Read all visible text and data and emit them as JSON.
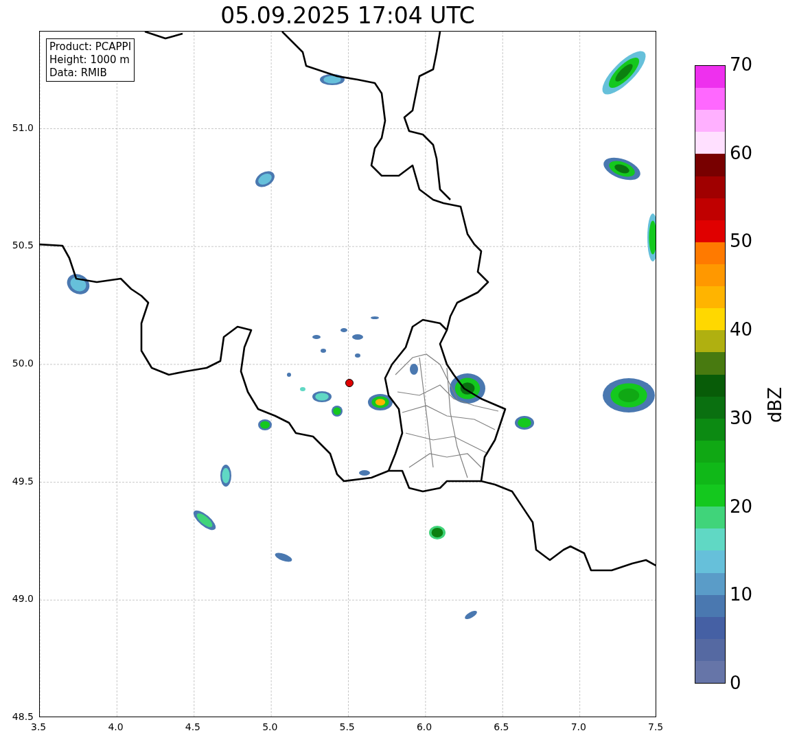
{
  "title": "05.09.2025 17:04 UTC",
  "info_box": [
    "Product: PCAPPI",
    "Height: 1000 m",
    "Data: RMIB"
  ],
  "x_axis": {
    "ticks": [
      "3.5",
      "4.0",
      "4.5",
      "5.0",
      "5.5",
      "6.0",
      "6.5",
      "7.0",
      "7.5"
    ]
  },
  "y_axis": {
    "ticks": [
      "51.0",
      "50.5",
      "50.0",
      "49.5",
      "49.0",
      "48.5"
    ]
  },
  "colorbar": {
    "label": "dBZ",
    "ticks": [
      "70",
      "60",
      "50",
      "40",
      "30",
      "20",
      "10",
      "0"
    ],
    "bands": [
      {
        "color": "#ee30ee"
      },
      {
        "color": "#ff68ff"
      },
      {
        "color": "#ffb0ff"
      },
      {
        "color": "#ffe0ff"
      },
      {
        "color": "#780000"
      },
      {
        "color": "#a00000"
      },
      {
        "color": "#c00000"
      },
      {
        "color": "#e00000"
      },
      {
        "color": "#ff7a00"
      },
      {
        "color": "#ff9800"
      },
      {
        "color": "#ffb400"
      },
      {
        "color": "#ffd800"
      },
      {
        "color": "#b0b010"
      },
      {
        "color": "#487a10"
      },
      {
        "color": "#085c08"
      },
      {
        "color": "#0a7010"
      },
      {
        "color": "#0c8a12"
      },
      {
        "color": "#10a814"
      },
      {
        "color": "#10b818"
      },
      {
        "color": "#14c81e"
      },
      {
        "color": "#40d47a"
      },
      {
        "color": "#60d8c4"
      },
      {
        "color": "#66c0da"
      },
      {
        "color": "#5a9cc8"
      },
      {
        "color": "#4a78b0"
      },
      {
        "color": "#4560a4"
      },
      {
        "color": "#5569a2"
      },
      {
        "color": "#6675a8"
      }
    ]
  }
}
